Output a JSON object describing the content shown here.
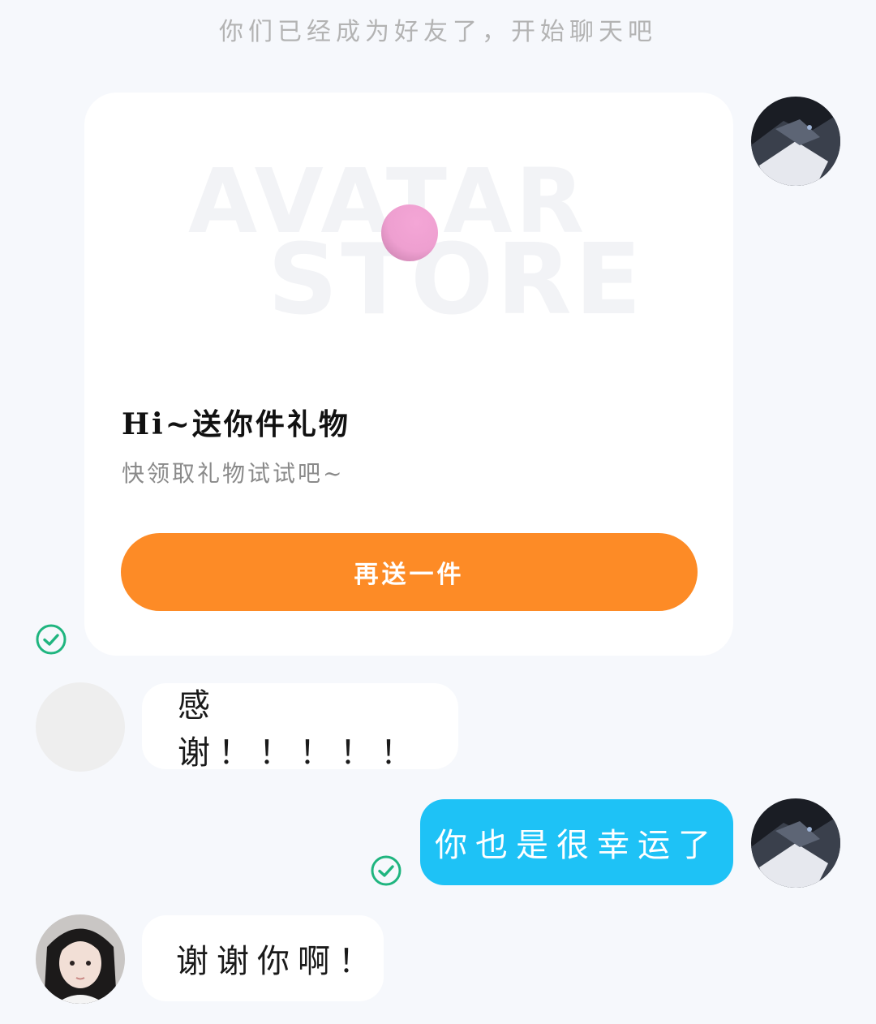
{
  "system_tip": "你们已经成为好友了，开始聊天吧",
  "gift_card": {
    "watermark_line1": "AVATAR",
    "watermark_line2": "STORE",
    "title": "Hi~送你件礼物",
    "description": "快领取礼物试试吧~",
    "button_label": "再送一件"
  },
  "messages": [
    {
      "side": "other",
      "text": "感谢！！！！！"
    },
    {
      "side": "me",
      "text": "你也是很幸运了"
    },
    {
      "side": "other",
      "text": "谢谢你啊！"
    }
  ],
  "colors": {
    "background": "#f6f8fc",
    "accent_orange": "#fd8b26",
    "my_bubble": "#1ec2f6",
    "read_check": "#1fb57f"
  },
  "icons": {
    "read_receipt": "check-circle-icon"
  }
}
